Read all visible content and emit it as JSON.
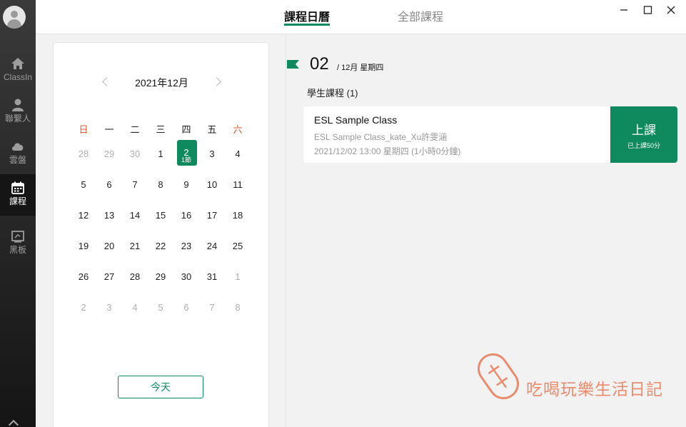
{
  "sidebar": {
    "items": [
      {
        "label": "ClassIn",
        "icon": "home-icon"
      },
      {
        "label": "聯繫人",
        "icon": "contacts-icon"
      },
      {
        "label": "雲盤",
        "icon": "cloud-icon"
      },
      {
        "label": "課程",
        "icon": "calendar-icon"
      },
      {
        "label": "黑板",
        "icon": "blackboard-icon"
      }
    ],
    "active": "課程"
  },
  "tabs": {
    "calendar": "課程日曆",
    "all": "全部課程"
  },
  "calendar": {
    "month_label": "2021年12月",
    "weekdays": [
      "日",
      "一",
      "二",
      "三",
      "四",
      "五",
      "六"
    ],
    "weeks": [
      [
        "28",
        "29",
        "30",
        "1",
        "2",
        "3",
        "4"
      ],
      [
        "5",
        "6",
        "7",
        "8",
        "9",
        "10",
        "11"
      ],
      [
        "12",
        "13",
        "14",
        "15",
        "16",
        "17",
        "18"
      ],
      [
        "19",
        "20",
        "21",
        "22",
        "23",
        "24",
        "25"
      ],
      [
        "26",
        "27",
        "28",
        "29",
        "30",
        "31",
        "1"
      ],
      [
        "2",
        "3",
        "4",
        "5",
        "6",
        "7",
        "8"
      ]
    ],
    "selected_sub": "1節",
    "today_label": "今天"
  },
  "detail": {
    "day": "02",
    "month_weekday": "/  12月  星期四",
    "section_title": "學生課程 (1)",
    "course": {
      "name": "ESL Sample Class",
      "subtitle": "ESL Sample Class_kate_Xu許雯涵",
      "time": "2021/12/02 13:00  星期四 (1小時0分鐘)",
      "join_label": "上課",
      "join_sub": "已上課50分"
    }
  },
  "watermark": {
    "text": "吃喝玩樂生活日記"
  },
  "colors": {
    "accent": "#0f8a5f",
    "weekend": "#e0542f",
    "watermark": "#e98b6c"
  }
}
